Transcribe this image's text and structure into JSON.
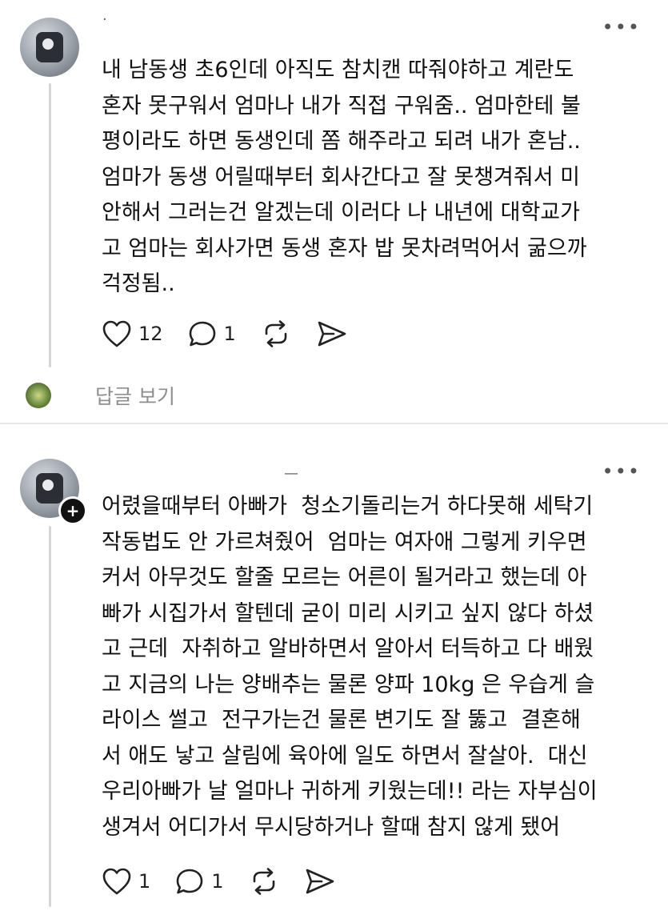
{
  "posts": [
    {
      "username": "·",
      "text": "내 남동생 초6인데 아직도 참치캔 따줘야하고 계란도\n혼자 못구워서 엄마나 내가 직접 구워줌.. 엄마한테 불\n평이라도 하면 동생인데 쫌 해주라고 되려 내가 혼남..\n엄마가 동생 어릴때부터 회사간다고 잘 못챙겨줘서 미\n안해서 그러는건 알겠는데 이러다 나 내년에 대학교가\n고 엄마는 회사가면 동생 혼자 밥 못차려먹어서 굶으까\n걱정됨..",
      "likes": "12",
      "replies": "1",
      "reply_link": "답글 보기"
    },
    {
      "username": "—",
      "text": "어렸을때부터 아빠가  청소기돌리는거 하다못해 세탁기\n작동법도 안 가르쳐줬어  엄마는 여자애 그렇게 키우면\n커서 아무것도 할줄 모르는 어른이 될거라고 했는데 아\n빠가 시집가서 할텐데 굳이 미리 시키고 싶지 않다 하셨\n고 근데  자취하고 알바하면서 알아서 터득하고 다 배웠\n고 지금의 나는 양배추는 물론 양파 10kg 은 우습게 슬\n라이스 썰고  전구가는건 물론 변기도 잘 뚫고  결혼해\n서 애도 낳고 살림에 육아에 일도 하면서 잘살아.  대신\n우리아빠가 날 얼마나 귀하게 키웠는데!! 라는 자부심이\n생겨서 어디가서 무시당하거나 할때 참지 않게 됐어",
      "likes": "1",
      "replies": "1"
    }
  ],
  "icons": {
    "more": "more-dots-icon",
    "like": "heart-icon",
    "comment": "comment-bubble-icon",
    "repost": "repost-icon",
    "share": "send-icon",
    "follow": "plus-icon"
  },
  "colors": {
    "text": "#111111",
    "muted": "#8e8e8e",
    "divider": "#e6e6e6",
    "thread_line": "#d6d6d6"
  }
}
